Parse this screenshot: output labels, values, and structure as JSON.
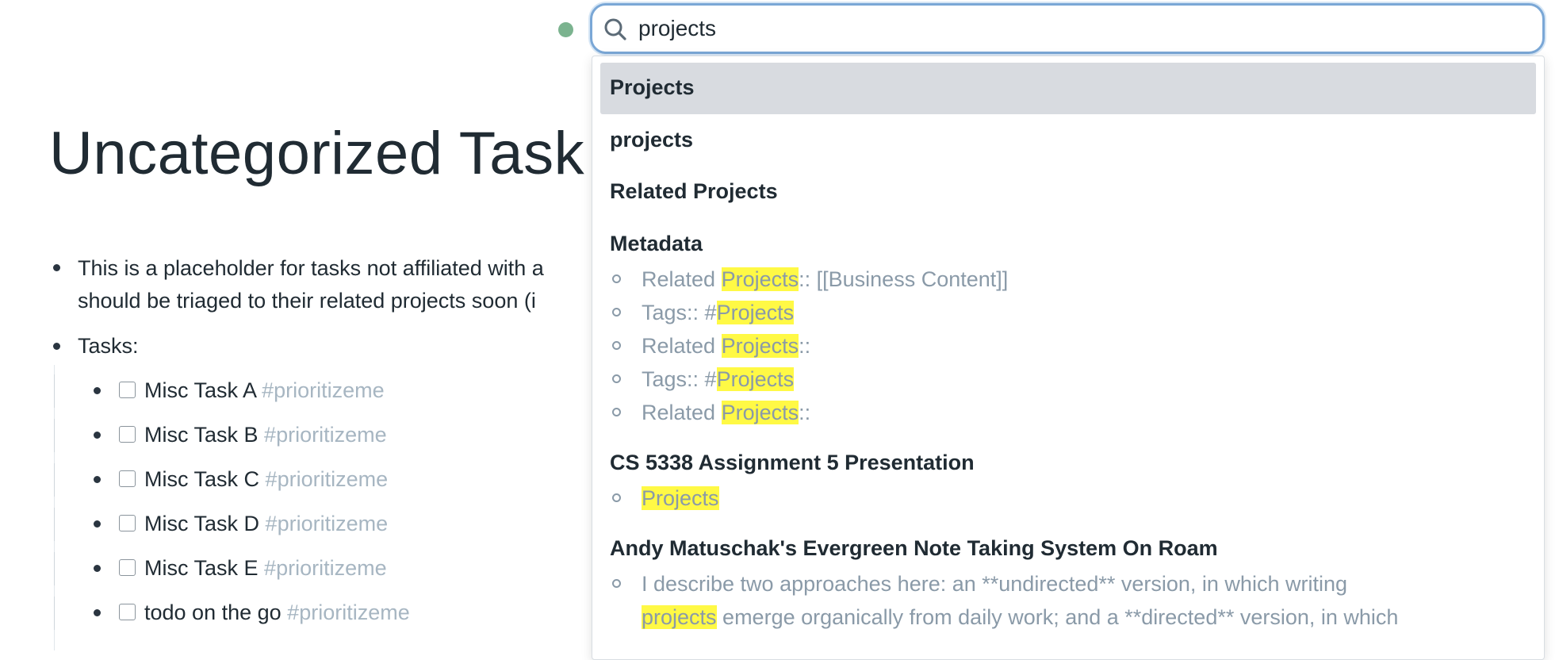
{
  "page": {
    "title": "Uncategorized Task",
    "intro_line1": "This is a placeholder for tasks not affiliated with a",
    "intro_line2": "should be triaged to their related projects soon (i",
    "tasks_label": "Tasks:",
    "tasks": [
      {
        "text": "Misc Task A",
        "tag": "#prioritizeme"
      },
      {
        "text": "Misc Task B",
        "tag": "#prioritizeme"
      },
      {
        "text": "Misc Task C",
        "tag": "#prioritizeme"
      },
      {
        "text": "Misc Task D",
        "tag": "#prioritizeme"
      },
      {
        "text": "Misc Task E",
        "tag": "#prioritizeme"
      },
      {
        "text": "todo on the go",
        "tag": "#prioritizeme"
      }
    ]
  },
  "search": {
    "value": "projects",
    "status_color": "#7bb38f"
  },
  "results": {
    "r1": "Projects",
    "r2": "projects",
    "r3": "Related Projects",
    "r4": {
      "title": "Metadata",
      "lines": [
        {
          "pre": "Related ",
          "hl": "Projects",
          "post": ":: [[Business Content]]"
        },
        {
          "pre": "Tags:: #",
          "hl": "Projects",
          "post": ""
        },
        {
          "pre": "Related ",
          "hl": "Projects",
          "post": "::"
        },
        {
          "pre": "Tags:: #",
          "hl": "Projects",
          "post": ""
        },
        {
          "pre": "Related ",
          "hl": "Projects",
          "post": "::"
        }
      ]
    },
    "r5": {
      "title": "CS 5338 Assignment 5 Presentation",
      "line": {
        "pre": "",
        "hl": "Projects",
        "post": ""
      }
    },
    "r6": {
      "title": "Andy Matuschak's Evergreen Note Taking System On Roam",
      "line1": "I describe two approaches here: an **undirected** version, in which writing",
      "line2": {
        "pre": "",
        "hl": "projects",
        "post": " emerge organically from daily work; and a **directed** version, in which"
      }
    },
    "highlight_color": "#fff945"
  }
}
